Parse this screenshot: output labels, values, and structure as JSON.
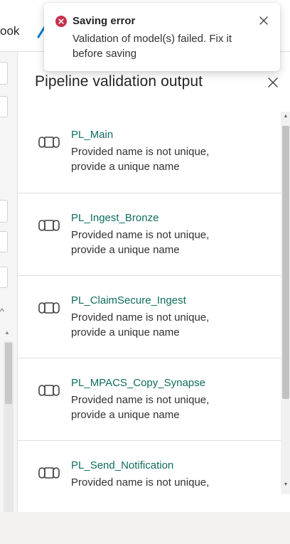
{
  "background": {
    "tab_fragment": "ook"
  },
  "toast": {
    "title": "Saving error",
    "message": "Validation of model(s) failed. Fix it before saving",
    "status_color": "#c4314b"
  },
  "panel": {
    "title": "Pipeline validation output",
    "items": [
      {
        "name": "PL_Main",
        "message": "Provided name is not unique, provide a unique name",
        "icon": "pipeline-icon"
      },
      {
        "name": "PL_Ingest_Bronze",
        "message": "Provided name is not unique, provide a unique name",
        "icon": "pipeline-icon"
      },
      {
        "name": "PL_ClaimSecure_Ingest",
        "message": "Provided name is not unique, provide a unique name",
        "icon": "pipeline-icon"
      },
      {
        "name": "PL_MPACS_Copy_Synapse",
        "message": "Provided name is not unique, provide a unique name",
        "icon": "pipeline-icon"
      },
      {
        "name": "PL_Send_Notification",
        "message": "Provided name is not unique,",
        "icon": "pipeline-icon"
      }
    ]
  },
  "colors": {
    "link": "#0f6c5d",
    "accent": "#0078d4"
  }
}
